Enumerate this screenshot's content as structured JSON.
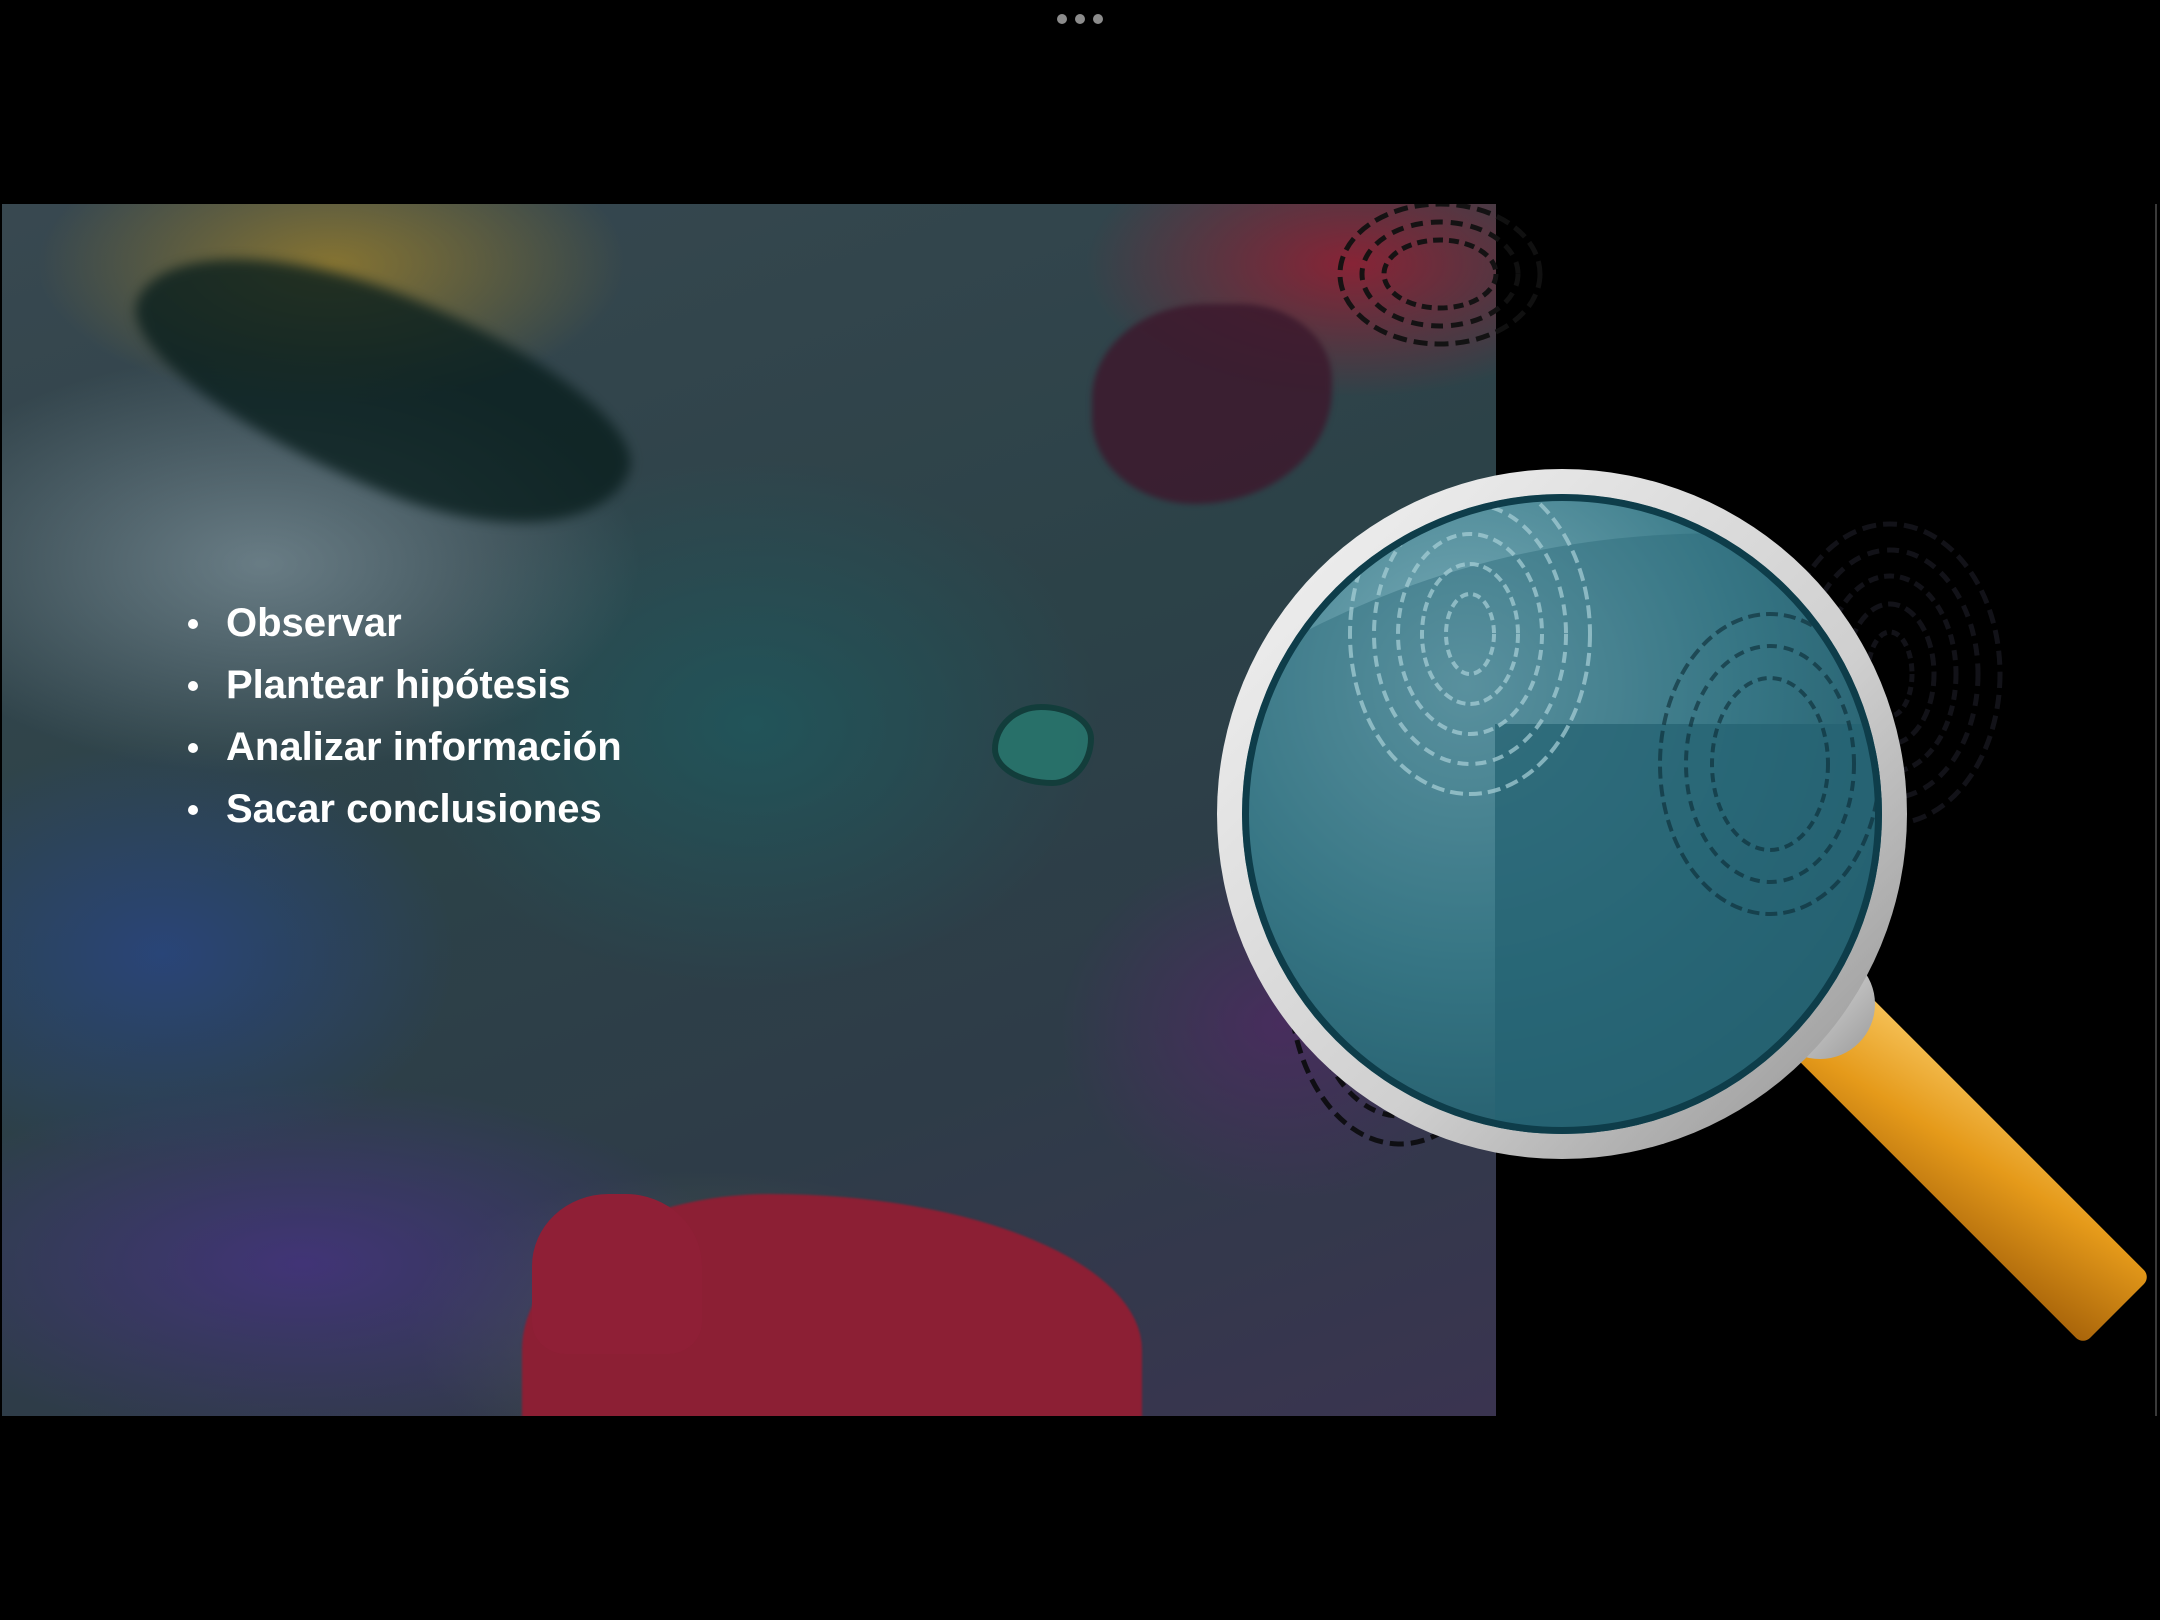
{
  "window": {
    "more_menu_icon": "ellipsis-icon"
  },
  "slide": {
    "bullets": [
      "Observar",
      "Plantear hipótesis",
      "Analizar información",
      "Sacar conclusiones"
    ],
    "illustration": {
      "icon": "magnifying-glass-fingerprint-icon",
      "handle_color": "#e59a1a",
      "lens_color": "#1f5c6c",
      "rim_color": "#d9d9d9"
    },
    "background_colors": {
      "teal": "#2c4248",
      "red_ink": "#8c1f34",
      "mustard": "#a08228",
      "purple": "#463282"
    }
  }
}
